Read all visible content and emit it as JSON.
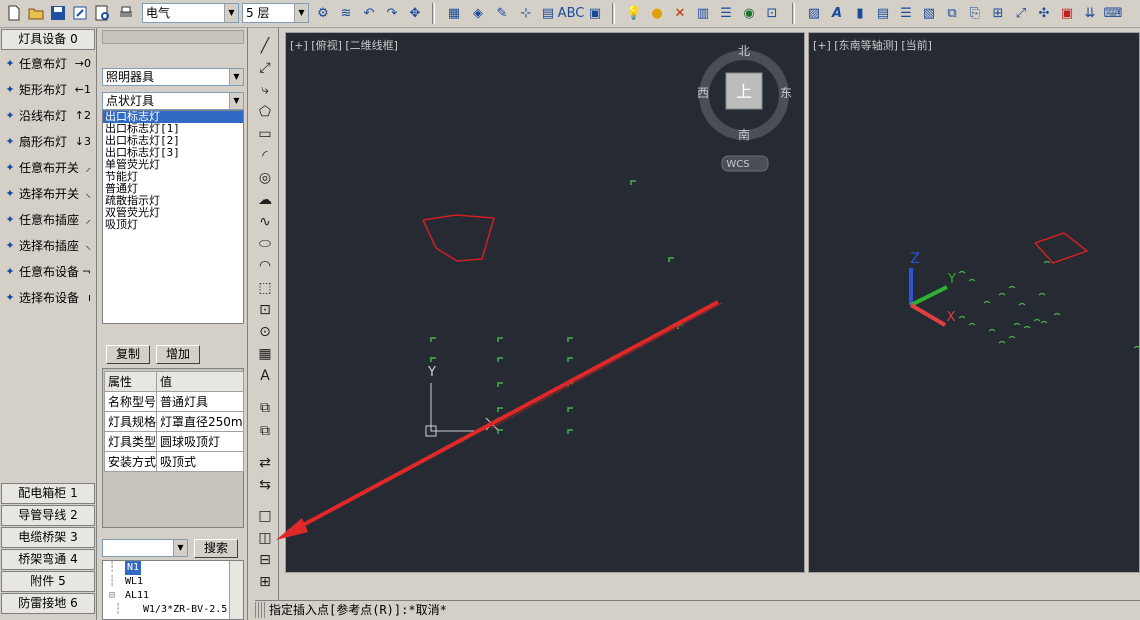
{
  "toolbar": {
    "category_combo": "电气",
    "floor_combo": "5 层"
  },
  "left_panel": {
    "header": "灯具设备 0",
    "tools": [
      {
        "label": "任意布灯",
        "shortcut": "→0",
        "icon": "point-icon"
      },
      {
        "label": "矩形布灯",
        "shortcut": "←1",
        "icon": "rect-grid-icon"
      },
      {
        "label": "沿线布灯",
        "shortcut": "↑2",
        "icon": "line-icon"
      },
      {
        "label": "扇形布灯",
        "shortcut": "↓3",
        "icon": "fan-icon"
      },
      {
        "label": "任意布开关",
        "shortcut": "⸝",
        "icon": "switch-icon"
      },
      {
        "label": "选择布开关",
        "shortcut": "⸜",
        "icon": "switch-select-icon"
      },
      {
        "label": "任意布插座",
        "shortcut": "⸝",
        "icon": "socket-icon"
      },
      {
        "label": "选择布插座",
        "shortcut": "⸜",
        "icon": "socket-select-icon"
      },
      {
        "label": "任意布设备",
        "shortcut": "¬",
        "icon": "device-icon"
      },
      {
        "label": "选择布设备",
        "shortcut": "ı",
        "icon": "device-select-icon"
      }
    ],
    "sections": [
      "配电箱柜 1",
      "导管导线 2",
      "电缆桥架 3",
      "桥架弯通 4",
      "附件 5",
      "防雷接地 6"
    ]
  },
  "middle_panel": {
    "category": "照明器具",
    "subcategory": "点状灯具",
    "items": [
      "出口标志灯",
      "出口标志灯[1]",
      "出口标志灯[2]",
      "出口标志灯[3]",
      "单管荧光灯",
      "节能灯",
      "普通灯",
      "疏散指示灯",
      "双管荧光灯",
      "吸顶灯"
    ],
    "selected_index": 0,
    "copy_button": "复制",
    "add_button": "增加",
    "props_header": {
      "name": "属性",
      "value": "值"
    },
    "props": [
      {
        "name": "名称型号",
        "value": "普通灯具"
      },
      {
        "name": "灯具规格",
        "value": "灯罩直径250m"
      },
      {
        "name": "灯具类型",
        "value": "圆球吸顶灯"
      },
      {
        "name": "安装方式",
        "value": "吸顶式"
      }
    ],
    "search_button": "搜索",
    "tree": [
      "N1",
      "WL1",
      "AL11",
      "W1/3*ZR-BV-2.5"
    ]
  },
  "viewport_left": {
    "label": "[+] [俯视] [二维线框]",
    "compass": {
      "north": "北",
      "south": "南",
      "east": "东",
      "west": "西",
      "center": "上"
    },
    "wcs": "WCS",
    "ucs_y": "Y",
    "colors": {
      "background": "#252a33",
      "red_lines": "#d02020",
      "green_marks": "#4caf50"
    }
  },
  "viewport_right": {
    "label": "[+] [东南等轴测] [当前]",
    "ucs_z": "Z",
    "ucs_y": "Y",
    "ucs_x": "X"
  },
  "command_line": "指定插入点[参考点(R)]:*取消*"
}
